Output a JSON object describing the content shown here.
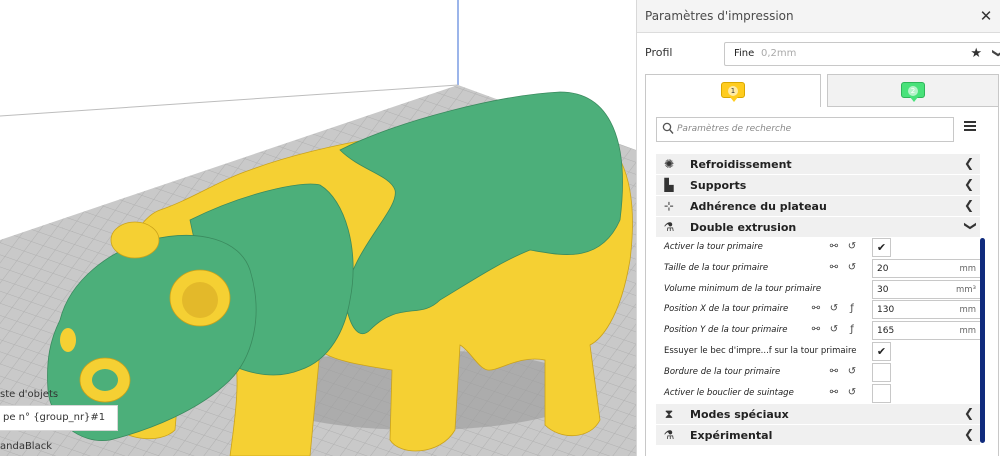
{
  "panel": {
    "title": "Paramètres d'impression",
    "close_icon": "close-icon"
  },
  "profile": {
    "label": "Profil",
    "name": "Fine",
    "sub": "0,2mm",
    "star_icon": "★",
    "chevron_icon": "❯"
  },
  "tabs": [
    {
      "number": "1",
      "color": "#ffcc1f"
    },
    {
      "number": "2",
      "color": "#49e27a"
    }
  ],
  "search": {
    "placeholder": "Paramètres de recherche"
  },
  "categories": {
    "cooling": "Refroidissement",
    "supports": "Supports",
    "adhesion": "Adhérence du plateau",
    "dual": "Double extrusion",
    "special": "Modes spéciaux",
    "experimental": "Expérimental"
  },
  "settings": {
    "prime_tower_enable": {
      "label": "Activer la tour primaire",
      "checked": true
    },
    "prime_tower_size": {
      "label": "Taille de la tour primaire",
      "value": "20",
      "unit": "mm"
    },
    "prime_tower_min_volume": {
      "label": "Volume minimum de la tour primaire",
      "value": "30",
      "unit": "mm³"
    },
    "prime_tower_pos_x": {
      "label": "Position X de la tour primaire",
      "value": "130",
      "unit": "mm"
    },
    "prime_tower_pos_y": {
      "label": "Position Y de la tour primaire",
      "value": "165",
      "unit": "mm"
    },
    "prime_tower_wipe": {
      "label": "Essuyer le bec d'impre...f sur la tour primaire",
      "checked": true
    },
    "prime_tower_brim": {
      "label": "Bordure de la tour primaire",
      "checked": false
    },
    "ooze_shield": {
      "label": "Activer le bouclier de suintage",
      "checked": false
    }
  },
  "object_list": {
    "title": "ste d'objets",
    "group_field": "pe n° {group_nr}#1",
    "object_name": "andaBlack"
  },
  "colors": {
    "body_green": "#4caf7a",
    "body_yellow": "#f5d033",
    "scroll": "#102b7d"
  }
}
